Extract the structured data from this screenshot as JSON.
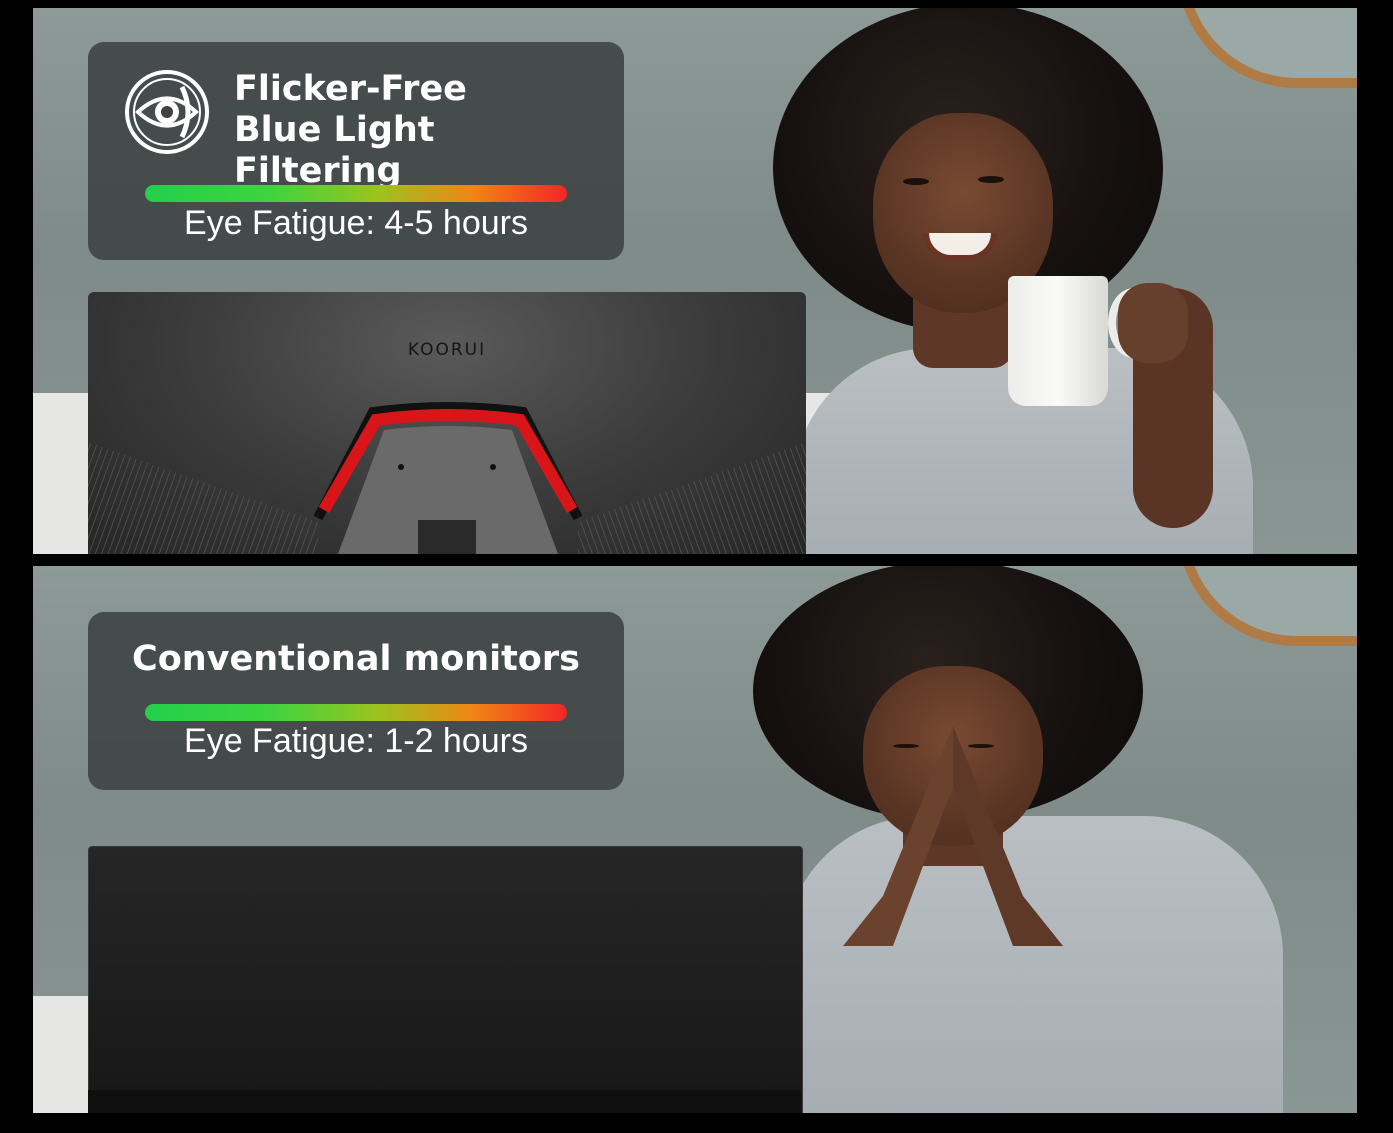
{
  "panels": {
    "top": {
      "badge_icon": "eye-shield-icon",
      "title_line1": "Flicker-Free",
      "title_line2": "Blue Light Filtering",
      "fatigue_label": "Eye Fatigue: 4-5 hours",
      "monitor_brand": "KOORUI"
    },
    "bottom": {
      "title": "Conventional monitors",
      "fatigue_label": "Eye Fatigue: 1-2 hours"
    }
  },
  "colors": {
    "box_background": "#3c4242",
    "bar_start": "#22d04a",
    "bar_end": "#f22626",
    "accent_red": "#d8161a"
  }
}
